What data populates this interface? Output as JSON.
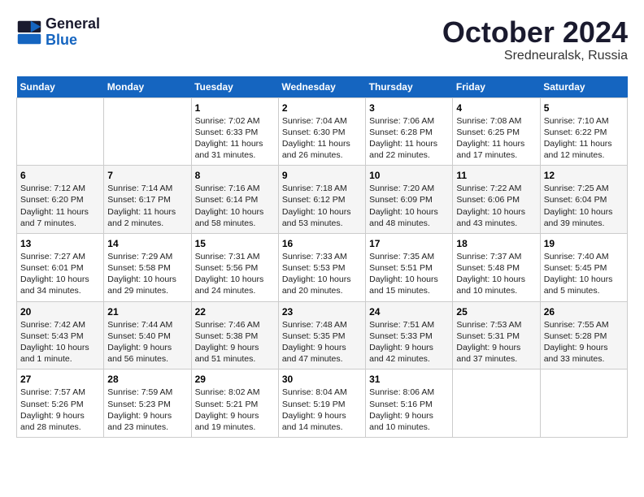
{
  "header": {
    "logo_line1": "General",
    "logo_line2": "Blue",
    "month": "October 2024",
    "location": "Sredneuralsk, Russia"
  },
  "weekdays": [
    "Sunday",
    "Monday",
    "Tuesday",
    "Wednesday",
    "Thursday",
    "Friday",
    "Saturday"
  ],
  "weeks": [
    [
      {
        "day": "",
        "content": ""
      },
      {
        "day": "",
        "content": ""
      },
      {
        "day": "1",
        "content": "Sunrise: 7:02 AM\nSunset: 6:33 PM\nDaylight: 11 hours and 31 minutes."
      },
      {
        "day": "2",
        "content": "Sunrise: 7:04 AM\nSunset: 6:30 PM\nDaylight: 11 hours and 26 minutes."
      },
      {
        "day": "3",
        "content": "Sunrise: 7:06 AM\nSunset: 6:28 PM\nDaylight: 11 hours and 22 minutes."
      },
      {
        "day": "4",
        "content": "Sunrise: 7:08 AM\nSunset: 6:25 PM\nDaylight: 11 hours and 17 minutes."
      },
      {
        "day": "5",
        "content": "Sunrise: 7:10 AM\nSunset: 6:22 PM\nDaylight: 11 hours and 12 minutes."
      }
    ],
    [
      {
        "day": "6",
        "content": "Sunrise: 7:12 AM\nSunset: 6:20 PM\nDaylight: 11 hours and 7 minutes."
      },
      {
        "day": "7",
        "content": "Sunrise: 7:14 AM\nSunset: 6:17 PM\nDaylight: 11 hours and 2 minutes."
      },
      {
        "day": "8",
        "content": "Sunrise: 7:16 AM\nSunset: 6:14 PM\nDaylight: 10 hours and 58 minutes."
      },
      {
        "day": "9",
        "content": "Sunrise: 7:18 AM\nSunset: 6:12 PM\nDaylight: 10 hours and 53 minutes."
      },
      {
        "day": "10",
        "content": "Sunrise: 7:20 AM\nSunset: 6:09 PM\nDaylight: 10 hours and 48 minutes."
      },
      {
        "day": "11",
        "content": "Sunrise: 7:22 AM\nSunset: 6:06 PM\nDaylight: 10 hours and 43 minutes."
      },
      {
        "day": "12",
        "content": "Sunrise: 7:25 AM\nSunset: 6:04 PM\nDaylight: 10 hours and 39 minutes."
      }
    ],
    [
      {
        "day": "13",
        "content": "Sunrise: 7:27 AM\nSunset: 6:01 PM\nDaylight: 10 hours and 34 minutes."
      },
      {
        "day": "14",
        "content": "Sunrise: 7:29 AM\nSunset: 5:58 PM\nDaylight: 10 hours and 29 minutes."
      },
      {
        "day": "15",
        "content": "Sunrise: 7:31 AM\nSunset: 5:56 PM\nDaylight: 10 hours and 24 minutes."
      },
      {
        "day": "16",
        "content": "Sunrise: 7:33 AM\nSunset: 5:53 PM\nDaylight: 10 hours and 20 minutes."
      },
      {
        "day": "17",
        "content": "Sunrise: 7:35 AM\nSunset: 5:51 PM\nDaylight: 10 hours and 15 minutes."
      },
      {
        "day": "18",
        "content": "Sunrise: 7:37 AM\nSunset: 5:48 PM\nDaylight: 10 hours and 10 minutes."
      },
      {
        "day": "19",
        "content": "Sunrise: 7:40 AM\nSunset: 5:45 PM\nDaylight: 10 hours and 5 minutes."
      }
    ],
    [
      {
        "day": "20",
        "content": "Sunrise: 7:42 AM\nSunset: 5:43 PM\nDaylight: 10 hours and 1 minute."
      },
      {
        "day": "21",
        "content": "Sunrise: 7:44 AM\nSunset: 5:40 PM\nDaylight: 9 hours and 56 minutes."
      },
      {
        "day": "22",
        "content": "Sunrise: 7:46 AM\nSunset: 5:38 PM\nDaylight: 9 hours and 51 minutes."
      },
      {
        "day": "23",
        "content": "Sunrise: 7:48 AM\nSunset: 5:35 PM\nDaylight: 9 hours and 47 minutes."
      },
      {
        "day": "24",
        "content": "Sunrise: 7:51 AM\nSunset: 5:33 PM\nDaylight: 9 hours and 42 minutes."
      },
      {
        "day": "25",
        "content": "Sunrise: 7:53 AM\nSunset: 5:31 PM\nDaylight: 9 hours and 37 minutes."
      },
      {
        "day": "26",
        "content": "Sunrise: 7:55 AM\nSunset: 5:28 PM\nDaylight: 9 hours and 33 minutes."
      }
    ],
    [
      {
        "day": "27",
        "content": "Sunrise: 7:57 AM\nSunset: 5:26 PM\nDaylight: 9 hours and 28 minutes."
      },
      {
        "day": "28",
        "content": "Sunrise: 7:59 AM\nSunset: 5:23 PM\nDaylight: 9 hours and 23 minutes."
      },
      {
        "day": "29",
        "content": "Sunrise: 8:02 AM\nSunset: 5:21 PM\nDaylight: 9 hours and 19 minutes."
      },
      {
        "day": "30",
        "content": "Sunrise: 8:04 AM\nSunset: 5:19 PM\nDaylight: 9 hours and 14 minutes."
      },
      {
        "day": "31",
        "content": "Sunrise: 8:06 AM\nSunset: 5:16 PM\nDaylight: 9 hours and 10 minutes."
      },
      {
        "day": "",
        "content": ""
      },
      {
        "day": "",
        "content": ""
      }
    ]
  ]
}
